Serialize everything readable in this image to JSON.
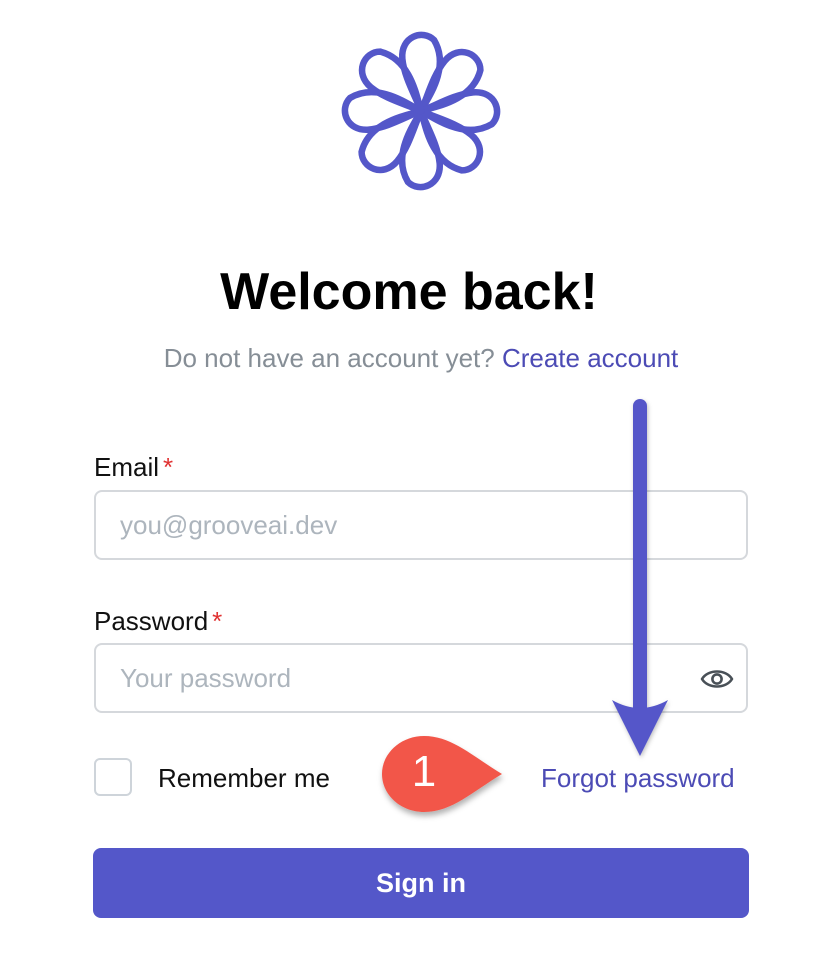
{
  "brand": {
    "logo_icon": "flower-swirl-logo-icon",
    "accent_color": "#5457c9"
  },
  "header": {
    "title": "Welcome back!",
    "subtitle_prefix": "Do not have an account yet?",
    "create_account_link": "Create account"
  },
  "form": {
    "email": {
      "label": "Email",
      "required_marker": "*",
      "placeholder": "you@grooveai.dev",
      "value": ""
    },
    "password": {
      "label": "Password",
      "required_marker": "*",
      "placeholder": "Your password",
      "value": "",
      "toggle_icon": "eye-icon"
    },
    "remember_me": {
      "label": "Remember me",
      "checked": false
    },
    "forgot_password_link": "Forgot password",
    "submit_label": "Sign in"
  },
  "annotation": {
    "step_number": "1",
    "badge_color": "#f2574a",
    "arrow_color": "#5457c9"
  }
}
